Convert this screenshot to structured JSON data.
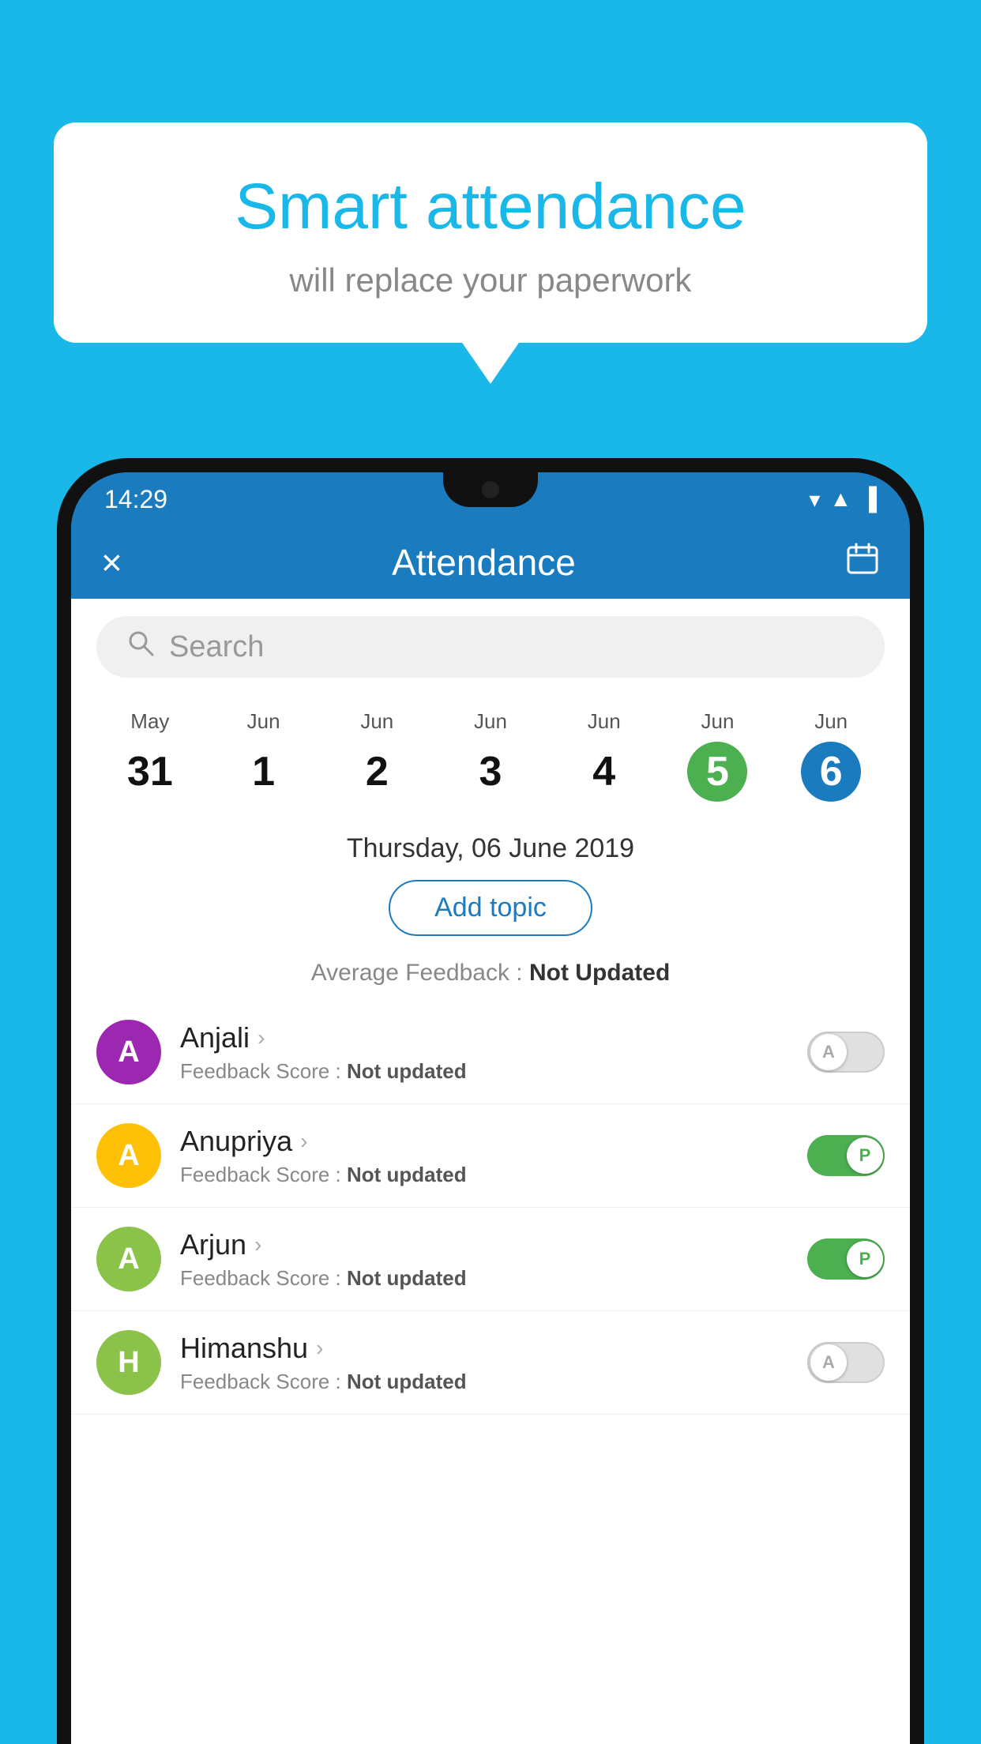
{
  "background_color": "#1ab8e8",
  "bubble": {
    "title": "Smart attendance",
    "subtitle": "will replace your paperwork"
  },
  "status_bar": {
    "time": "14:29",
    "wifi_icon": "▼",
    "signal_icon": "▲",
    "battery_icon": "▐"
  },
  "header": {
    "close_label": "×",
    "title": "Attendance",
    "calendar_icon": "📅"
  },
  "search": {
    "placeholder": "Search"
  },
  "calendar": {
    "dates": [
      {
        "month": "May",
        "day": "31",
        "style": "normal"
      },
      {
        "month": "Jun",
        "day": "1",
        "style": "normal"
      },
      {
        "month": "Jun",
        "day": "2",
        "style": "normal"
      },
      {
        "month": "Jun",
        "day": "3",
        "style": "normal"
      },
      {
        "month": "Jun",
        "day": "4",
        "style": "normal"
      },
      {
        "month": "Jun",
        "day": "5",
        "style": "green"
      },
      {
        "month": "Jun",
        "day": "6",
        "style": "blue"
      }
    ]
  },
  "selected_date": "Thursday, 06 June 2019",
  "add_topic_label": "Add topic",
  "avg_feedback_label": "Average Feedback : ",
  "avg_feedback_value": "Not Updated",
  "students": [
    {
      "name": "Anjali",
      "initial": "A",
      "avatar_color": "#9c27b0",
      "feedback_label": "Feedback Score : ",
      "feedback_value": "Not updated",
      "toggle_state": "off",
      "toggle_letter": "A"
    },
    {
      "name": "Anupriya",
      "initial": "A",
      "avatar_color": "#ffc107",
      "feedback_label": "Feedback Score : ",
      "feedback_value": "Not updated",
      "toggle_state": "on",
      "toggle_letter": "P"
    },
    {
      "name": "Arjun",
      "initial": "A",
      "avatar_color": "#8bc34a",
      "feedback_label": "Feedback Score : ",
      "feedback_value": "Not updated",
      "toggle_state": "on",
      "toggle_letter": "P"
    },
    {
      "name": "Himanshu",
      "initial": "H",
      "avatar_color": "#8bc34a",
      "feedback_label": "Feedback Score : ",
      "feedback_value": "Not updated",
      "toggle_state": "off",
      "toggle_letter": "A"
    }
  ]
}
